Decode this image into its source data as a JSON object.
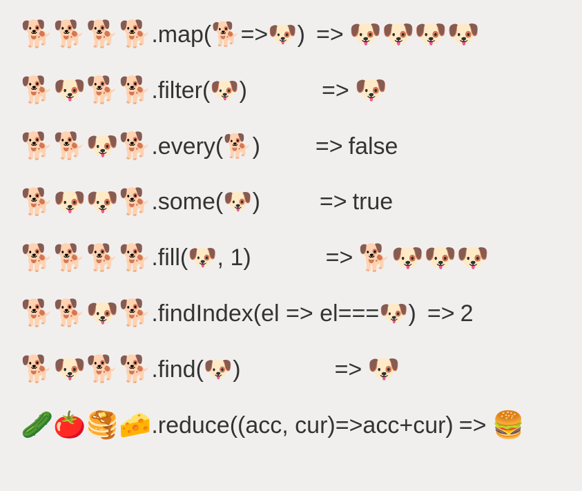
{
  "emojis": {
    "dog": "🐕",
    "dogface": "🐶",
    "cucumber": "🥒",
    "tomato": "🍅",
    "pancakes": "🥞",
    "cheese": "🧀",
    "burger": "🍔"
  },
  "rows": [
    {
      "input": [
        "dog",
        "dog",
        "dog",
        "dog"
      ],
      "method_pre": ".map(",
      "method_args_emojis": [
        "dog"
      ],
      "method_mid": "=>",
      "method_args_emojis2": [
        "dogface"
      ],
      "method_post": ")",
      "arrow_spacing": 8,
      "result_type": "emojis",
      "result_emojis": [
        "dogface",
        "dogface",
        "dogface",
        "dogface"
      ],
      "result_text": ""
    },
    {
      "input": [
        "dog",
        "dogface",
        "dog",
        "dog"
      ],
      "method_pre": ".filter(",
      "method_args_emojis": [
        "dogface"
      ],
      "method_mid": "",
      "method_args_emojis2": [],
      "method_post": ")",
      "arrow_spacing": 100,
      "result_type": "emojis",
      "result_emojis": [
        "dogface"
      ],
      "result_text": ""
    },
    {
      "input": [
        "dog",
        "dog",
        "dogface",
        "dog"
      ],
      "method_pre": ".every(",
      "method_args_emojis": [
        "dog"
      ],
      "method_mid": "",
      "method_args_emojis2": [],
      "method_post": ")",
      "arrow_spacing": 72,
      "result_type": "text",
      "result_emojis": [],
      "result_text": "false"
    },
    {
      "input": [
        "dog",
        "dogface",
        "dogface",
        "dog"
      ],
      "method_pre": ".some(",
      "method_args_emojis": [
        "dogface"
      ],
      "method_mid": "",
      "method_args_emojis2": [],
      "method_post": ")",
      "arrow_spacing": 78,
      "result_type": "text",
      "result_emojis": [],
      "result_text": "true"
    },
    {
      "input": [
        "dog",
        "dog",
        "dog",
        "dog"
      ],
      "method_pre": ".fill(",
      "method_args_emojis": [
        "dogface"
      ],
      "method_mid": "",
      "method_args_emojis2": [],
      "method_post": ", 1)",
      "arrow_spacing": 100,
      "result_type": "emojis",
      "result_emojis": [
        "dog",
        "dogface",
        "dogface",
        "dogface"
      ],
      "result_text": ""
    },
    {
      "input": [
        "dog",
        "dog",
        "dogface",
        "dog"
      ],
      "method_pre": ".findIndex(el => el===",
      "method_args_emojis": [
        "dogface"
      ],
      "method_mid": "",
      "method_args_emojis2": [],
      "method_post": ")",
      "arrow_spacing": 8,
      "result_type": "text",
      "result_emojis": [],
      "result_text": "2"
    },
    {
      "input": [
        "dog",
        "dogface",
        "dog",
        "dog"
      ],
      "method_pre": ".find(",
      "method_args_emojis": [
        "dogface"
      ],
      "method_mid": "",
      "method_args_emojis2": [],
      "method_post": ")",
      "arrow_spacing": 128,
      "result_type": "emojis",
      "result_emojis": [
        "dogface"
      ],
      "result_text": ""
    },
    {
      "input": [
        "cucumber",
        "tomato",
        "pancakes",
        "cheese"
      ],
      "method_pre": ".reduce((acc, cur)=>acc+cur)",
      "method_args_emojis": [],
      "method_mid": "",
      "method_args_emojis2": [],
      "method_post": "",
      "arrow_spacing": 0,
      "result_type": "emojis",
      "result_emojis": [
        "burger"
      ],
      "result_text": ""
    }
  ],
  "arrow": "=>"
}
